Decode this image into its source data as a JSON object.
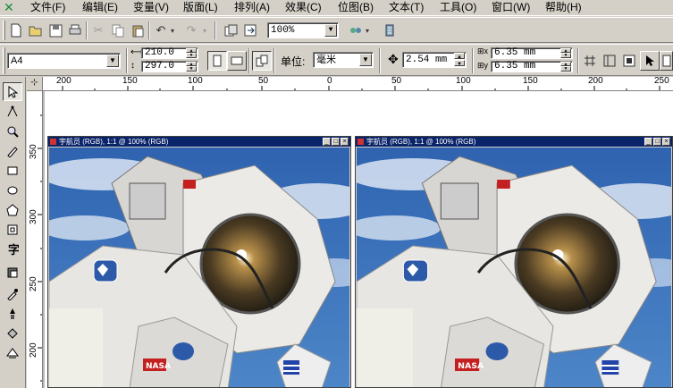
{
  "menu": {
    "logo_icon": "coreldraw-logo-icon",
    "items": [
      {
        "label": "文件(F)"
      },
      {
        "label": "编辑(E)"
      },
      {
        "label": "变量(V)"
      },
      {
        "label": "版面(L)"
      },
      {
        "label": "排列(A)"
      },
      {
        "label": "效果(C)"
      },
      {
        "label": "位图(B)"
      },
      {
        "label": "文本(T)"
      },
      {
        "label": "工具(O)"
      },
      {
        "label": "窗口(W)"
      },
      {
        "label": "帮助(H)"
      }
    ]
  },
  "toolbar": {
    "icons": [
      "new-icon",
      "open-icon",
      "save-icon",
      "print-icon",
      "cut-icon",
      "copy-icon",
      "paste-icon",
      "undo-icon",
      "redo-icon",
      "import-icon",
      "export-icon",
      "wireframe-icon"
    ],
    "zoom_value": "100%"
  },
  "propbar": {
    "page_size": "A4",
    "width": "210.0",
    "height": "297.0",
    "units_label": "单位:",
    "units_value": "毫米",
    "nudge": "2.54 mm",
    "dup_x": "6.35 mm",
    "dup_y": "6.35 mm"
  },
  "ruler": {
    "h_labels": [
      "200",
      "150",
      "100",
      "50",
      "0",
      "50",
      "100",
      "150",
      "200",
      "250"
    ],
    "v_labels": [
      "350",
      "300",
      "250",
      "200"
    ]
  },
  "toolbox": {
    "tools": [
      "pick-tool-icon",
      "shape-tool-icon",
      "zoom-tool-icon",
      "freehand-tool-icon",
      "rectangle-tool-icon",
      "ellipse-tool-icon",
      "polygon-tool-icon",
      "spiral-tool-icon",
      "text-tool-icon",
      "interactive-fill-icon",
      "eyedropper-tool-icon",
      "outline-tool-icon",
      "fill-tool-icon",
      "interactive-tool-icon"
    ]
  },
  "documents": [
    {
      "title": "宇航员 (RGB), 1:1 @ 100% (RGB)"
    },
    {
      "title": "宇航员 (RGB), 1:1 @ 100% (RGB)"
    }
  ],
  "colors": {
    "title_bar": "#0a246a",
    "sky": "#3b6eb4",
    "suit": "#e8e6e2"
  }
}
